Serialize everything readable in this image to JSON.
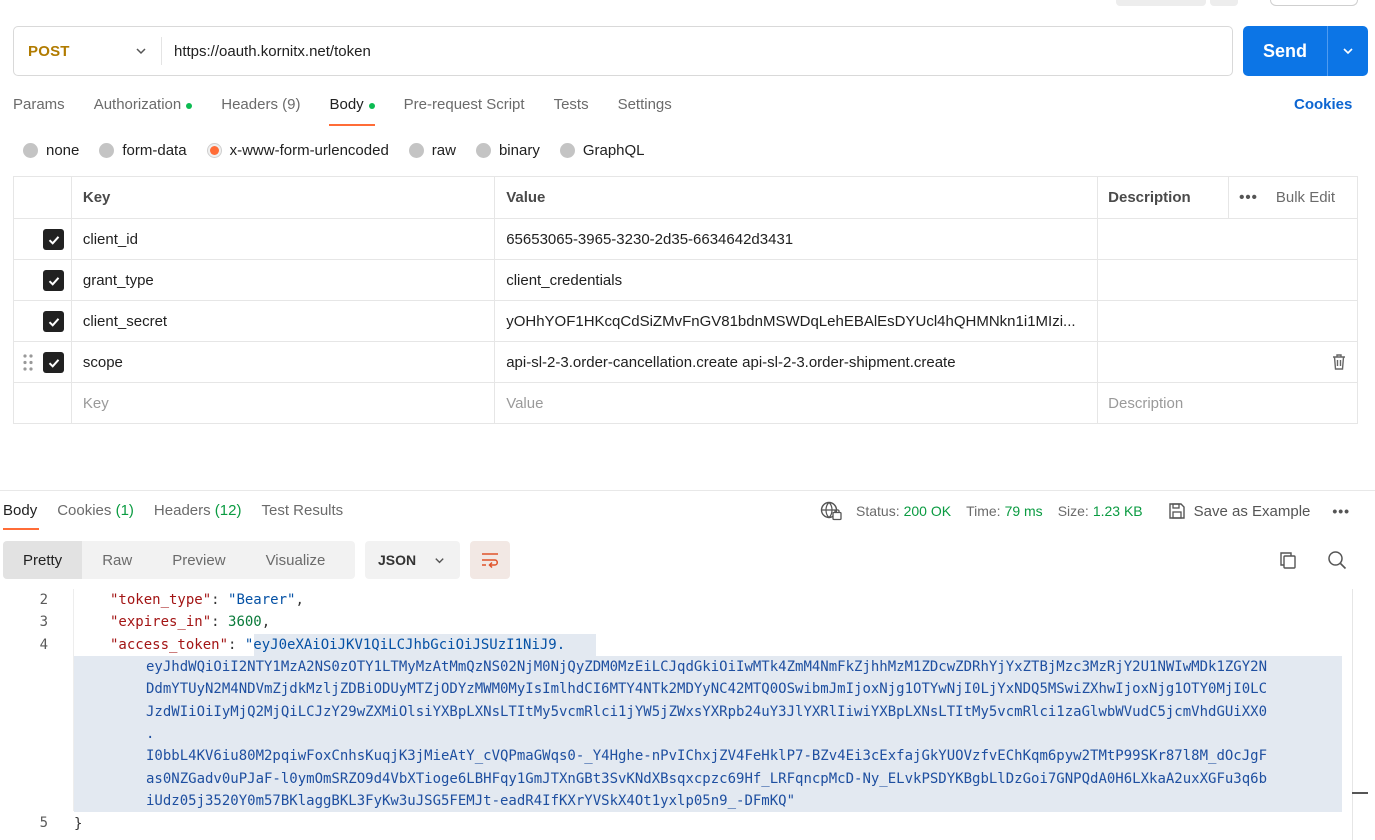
{
  "request": {
    "method": "POST",
    "url": "https://oauth.kornitx.net/token",
    "send_label": "Send"
  },
  "request_tabs": [
    {
      "label": "Params"
    },
    {
      "label": "Authorization",
      "dot": true
    },
    {
      "label": "Headers",
      "count": "(9)"
    },
    {
      "label": "Body",
      "dot": true,
      "active": true
    },
    {
      "label": "Pre-request Script"
    },
    {
      "label": "Tests"
    },
    {
      "label": "Settings"
    }
  ],
  "cookies_label": "Cookies",
  "body_types": [
    "none",
    "form-data",
    "x-www-form-urlencoded",
    "raw",
    "binary",
    "GraphQL"
  ],
  "body_type_selected": "x-www-form-urlencoded",
  "table": {
    "headers": {
      "key": "Key",
      "value": "Value",
      "description": "Description",
      "bulk_edit": "Bulk Edit"
    },
    "rows": [
      {
        "key": "client_id",
        "value": "65653065-3965-3230-2d35-6634642d3431",
        "checked": true
      },
      {
        "key": "grant_type",
        "value": "client_credentials",
        "checked": true
      },
      {
        "key": "client_secret",
        "value": "yOHhYOF1HKcqCdSiZMvFnGV81bdnMSWDqLehEBAlEsDYUcl4hQHMNkn1i1MIzi...",
        "checked": true
      },
      {
        "key": "scope",
        "value": "api-sl-2-3.order-cancellation.create api-sl-2-3.order-shipment.create",
        "checked": true
      }
    ],
    "placeholder": {
      "key": "Key",
      "value": "Value",
      "description": "Description"
    }
  },
  "response": {
    "tabs": {
      "body": "Body",
      "cookies": "Cookies",
      "cookies_count": "(1)",
      "headers": "Headers",
      "headers_count": "(12)",
      "test_results": "Test Results"
    },
    "status_label": "Status:",
    "status_value": "200 OK",
    "time_label": "Time:",
    "time_value": "79 ms",
    "size_label": "Size:",
    "size_value": "1.23 KB",
    "save_example": "Save as Example",
    "view_modes": [
      "Pretty",
      "Raw",
      "Preview",
      "Visualize"
    ],
    "format": "JSON",
    "line_numbers": [
      "2",
      "3",
      "4",
      "5"
    ],
    "token_type_key": "\"token_type\"",
    "token_type_value": "\"Bearer\"",
    "expires_in_key": "\"expires_in\"",
    "expires_in_value": "3600",
    "access_token_key": "\"access_token\"",
    "access_token_lines": [
      "\"eyJ0eXAiOiJKV1QiLCJhbGciOiJSUzI1NiJ9.",
      "eyJhdWQiOiI2NTY1MzA2NS0zOTY1LTMyMzAtMmQzNS02NjM0NjQyZDM0MzEiLCJqdGkiOiIwMTk4ZmM4NmFkZjhhMzM1ZDcwZDRhYjYxZTBjMzc3MzRjY2U1NWIwMDk1ZGY2N",
      "DdmYTUyN2M4NDVmZjdkMzljZDBiODUyMTZjODYzMWM0MyIsImlhdCI6MTY4NTk2MDYyNC42MTQ0OSwibmJmIjoxNjg1OTYwNjI0LjYxNDQ5MSwiZXhwIjoxNjg1OTY0MjI0LC",
      "JzdWIiOiIyMjQ2MjQiLCJzY29wZXMiOlsiYXBpLXNsLTItMy5vcmRlci1jYW5jZWxsYXRpb24uY3JlYXRlIiwiYXBpLXNsLTItMy5vcmRlci1zaGlwbWVudC5jcmVhdGUiXX0",
      ".",
      "I0bbL4KV6iu80M2pqiwFoxCnhsKuqjK3jMieAtY_cVQPmaGWqs0-_Y4Hghe-nPvIChxjZV4FeHklP7-BZv4Ei3cExfajGkYUOVzfvEChKqm6pyw2TMtP99SKr87l8M_dOcJgF",
      "as0NZGadv0uPJaF-l0ymOmSRZO9d4VbXTioge6LBHFqy1GmJTXnGBt3SvKNdXBsqxcpzc69Hf_LRFqncpMcD-Ny_ELvkPSDYKBgbLlDzGoi7GNPQdA0H6LXkaA2uxXGFu3q6b",
      "iUdz05j3520Y0m57BKlaggBKL3FyKw3uJSG5FEMJt-eadR4IfKXrYVSkX4Ot1yxlp05n9_-DFmKQ\""
    ],
    "closing_brace": "}"
  }
}
